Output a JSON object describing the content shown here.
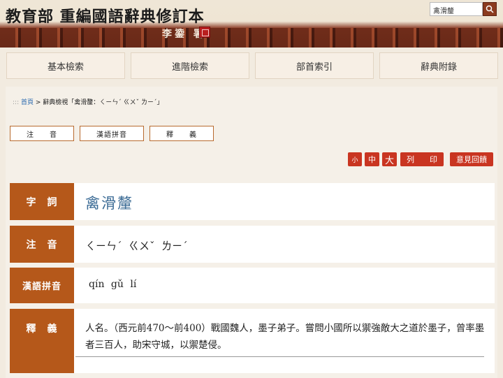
{
  "header": {
    "title": "教育部 重編國語辭典修訂本",
    "signature": "李鍌 署",
    "search_value": "禽滑釐"
  },
  "nav": [
    "基本檢索",
    "進階檢索",
    "部首索引",
    "辭典附錄"
  ],
  "breadcrumb": {
    "dots": ":::",
    "home": "首頁",
    "sep": " > ",
    "current": "辭典檢視「禽滑釐：ㄑㄧㄣˊ ㄍㄨˇ ㄌㄧˊ」"
  },
  "tabs": [
    "注　　音",
    "漢語拼音",
    "釋　　義"
  ],
  "tools": {
    "small": "小",
    "medium": "中",
    "large": "大",
    "print": "列　　印",
    "feedback": "意見回饋"
  },
  "entry": {
    "word_label": "字　詞",
    "word": "禽滑釐",
    "zhuyin_label": "注　音",
    "zhuyin": "ㄑㄧㄣˊ  ㄍㄨˇ  ㄌㄧˊ",
    "pinyin_label": "漢語拼音",
    "pinyin": "qín gǔ lí",
    "def_label": "釋　義",
    "definition": "人名。（西元前470～前400）戰國魏人，墨子弟子。嘗問小國所以禦強敵大之道於墨子，曾率墨者三百人，助宋守城，以禦楚侵。"
  },
  "colors": {
    "accent": "#b5581a",
    "button": "#c93521",
    "link": "#2d6bb0"
  }
}
